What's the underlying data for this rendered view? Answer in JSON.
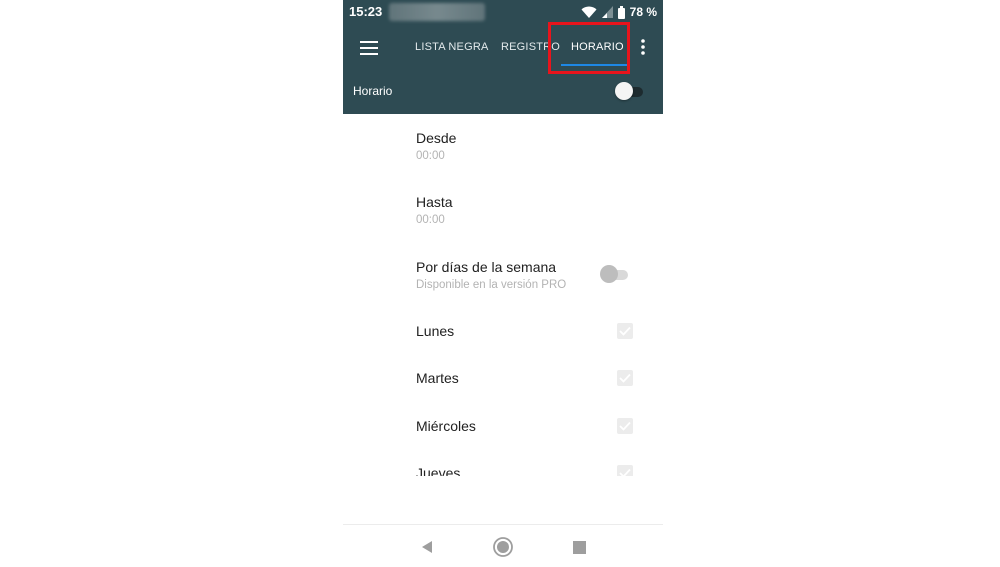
{
  "status_bar": {
    "time": "15:23",
    "battery": "78 %",
    "icons": [
      "wifi-icon",
      "signal-icon",
      "battery-icon"
    ]
  },
  "app_bar": {
    "tabs": [
      {
        "label": "LISTA NEGRA",
        "active": false
      },
      {
        "label": "REGISTRO",
        "active": false
      },
      {
        "label": "HORARIO",
        "active": true
      }
    ],
    "schedule_toggle": {
      "label": "Horario",
      "on": false
    }
  },
  "settings": {
    "desde": {
      "title": "Desde",
      "value": "00:00"
    },
    "hasta": {
      "title": "Hasta",
      "value": "00:00"
    },
    "por_dias": {
      "title": "Por días de la semana",
      "summary": "Disponible en la versión PRO",
      "on": false
    },
    "days": [
      {
        "label": "Lunes",
        "checked": true
      },
      {
        "label": "Martes",
        "checked": true
      },
      {
        "label": "Miércoles",
        "checked": true
      },
      {
        "label": "Jueves",
        "checked": true
      }
    ]
  },
  "colors": {
    "app_bar": "#2e4b53",
    "tab_indicator": "#1e88e5",
    "highlight": "#e8141c",
    "secondary_text": "#b3b3b3"
  },
  "nav_bar": {
    "icons": [
      "back-icon",
      "home-icon",
      "recents-icon"
    ]
  }
}
